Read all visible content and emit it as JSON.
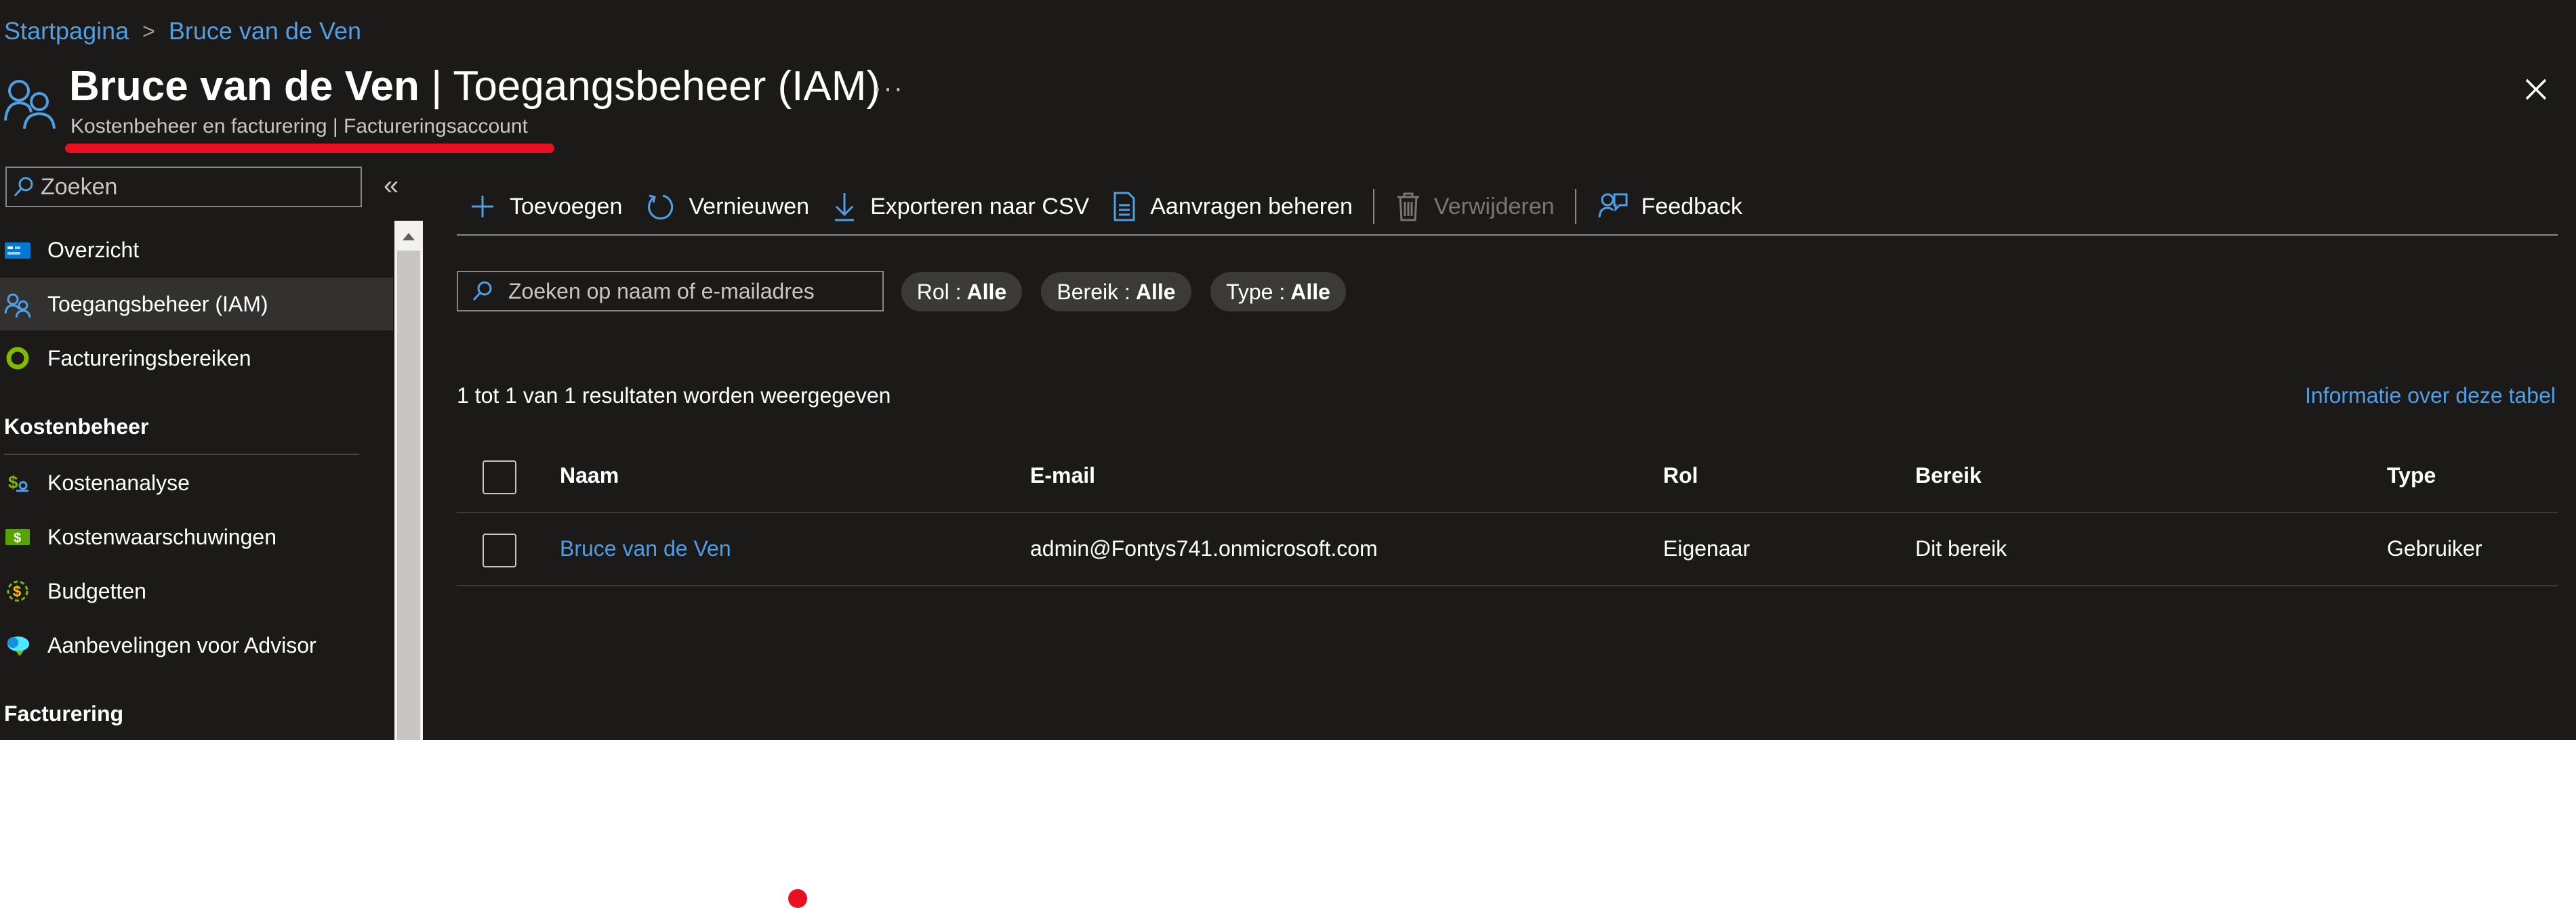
{
  "breadcrumb": {
    "home": "Startpagina",
    "separator": ">",
    "current": "Bruce van de Ven"
  },
  "header": {
    "title_name": "Bruce van de Ven",
    "title_rest": " | Toegangsbeheer (IAM)",
    "subtitle": "Kostenbeheer en facturering | Factureringsaccount",
    "more": "···",
    "close_icon": "close-icon"
  },
  "sidebar": {
    "search_placeholder": "Zoeken",
    "collapse": "«",
    "items": [
      {
        "label": "Overzicht",
        "icon": "overview-icon"
      },
      {
        "label": "Toegangsbeheer (IAM)",
        "icon": "people-icon",
        "active": true
      },
      {
        "label": "Factureringsbereiken",
        "icon": "circle-icon"
      }
    ],
    "section_cost": "Kostenbeheer",
    "cost_items": [
      {
        "label": "Kostenanalyse",
        "icon": "cost-analysis-icon"
      },
      {
        "label": "Kostenwaarschuwingen",
        "icon": "cost-alert-icon"
      },
      {
        "label": "Budgetten",
        "icon": "budget-icon"
      },
      {
        "label": "Aanbevelingen voor Advisor",
        "icon": "advisor-icon"
      }
    ],
    "section_billing": "Facturering"
  },
  "toolbar": {
    "add": "Toevoegen",
    "refresh": "Vernieuwen",
    "export": "Exporteren naar CSV",
    "manage_requests": "Aanvragen beheren",
    "delete": "Verwijderen",
    "feedback": "Feedback"
  },
  "filters": {
    "search_placeholder": "Zoeken op naam of e-mailadres",
    "role_label": "Rol :",
    "role_value": "Alle",
    "scope_label": "Bereik :",
    "scope_value": "Alle",
    "type_label": "Type :",
    "type_value": "Alle"
  },
  "results_text": "1 tot 1 van 1 resultaten worden weergegeven",
  "table_info_link": "Informatie over deze tabel",
  "table": {
    "columns": [
      "Naam",
      "E-mail",
      "Rol",
      "Bereik",
      "Type"
    ],
    "rows": [
      {
        "name": "Bruce van de Ven",
        "email": "admin@Fontys741.onmicrosoft.com",
        "role": "Eigenaar",
        "scope": "Dit bereik",
        "type": "Gebruiker"
      }
    ]
  },
  "colors": {
    "background": "#1b1a19",
    "link": "#4f9fe5",
    "accent_red": "#e81123",
    "active_nav": "#323130"
  }
}
